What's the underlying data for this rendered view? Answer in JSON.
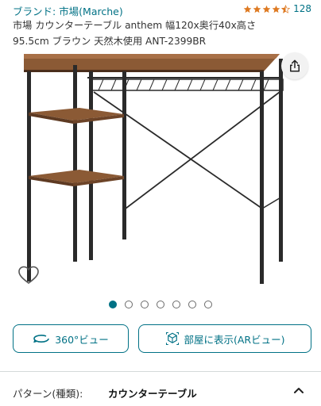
{
  "brand": {
    "link_text": "ブランド: 市場(Marche)"
  },
  "rating": {
    "stars": 4.5,
    "count": "128",
    "star_color": "#de7921"
  },
  "product": {
    "title": "市場 カウンターテーブル anthem 幅120x奥行40x高さ95.5cm ブラウン 天然木使用 ANT-2399BR"
  },
  "gallery": {
    "total_images": 7,
    "active_index": 0
  },
  "actions": {
    "view360_label": "360°ビュー",
    "ar_label": "部屋に表示(ARビュー)"
  },
  "pattern": {
    "label": "パターン(種類):",
    "value": "カウンターテーブル"
  },
  "icons": {
    "share": "share-icon",
    "heart": "heart-icon",
    "rotate": "rotate-360-icon",
    "ar": "ar-cube-icon",
    "chevron": "chevron-up-icon"
  },
  "colors": {
    "link": "#007185",
    "accent": "#007185"
  }
}
